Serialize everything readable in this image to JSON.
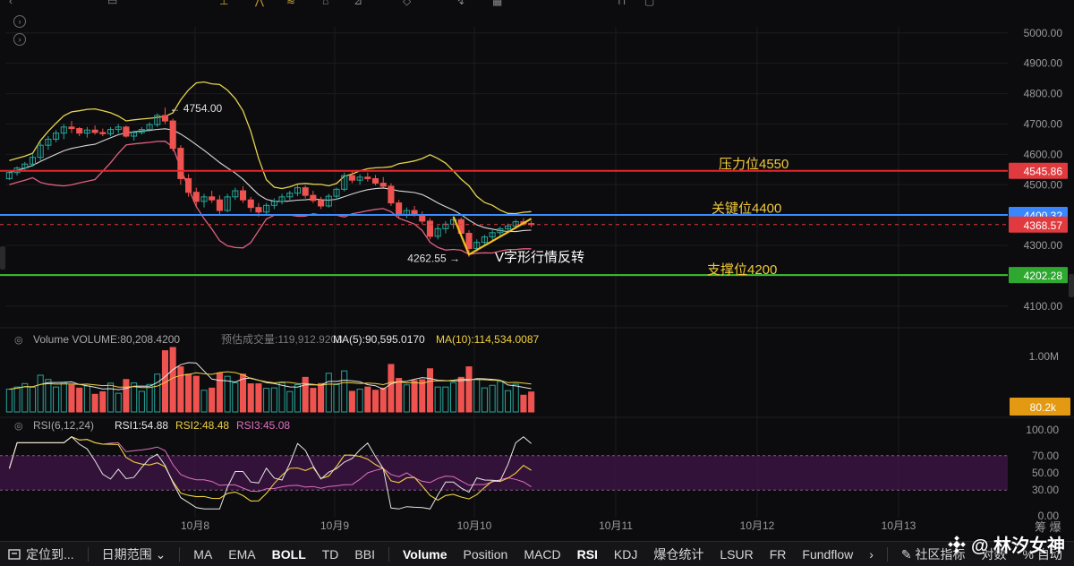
{
  "chart_data": {
    "type": "candlestick",
    "x_ticks": [
      "10月8",
      "10月9",
      "10月10",
      "10月11",
      "10月12",
      "10月13"
    ],
    "price_axis_ticks": [
      "5000.00",
      "4900.00",
      "4800.00",
      "4700.00",
      "4600.00",
      "4500.00",
      "4400.00",
      "4300.00",
      "4200.00",
      "4100.00"
    ],
    "ylim": [
      4070,
      5020
    ],
    "candles": [
      [
        4520,
        4545,
        4515,
        4540
      ],
      [
        4540,
        4560,
        4530,
        4555
      ],
      [
        4555,
        4575,
        4548,
        4568
      ],
      [
        4568,
        4600,
        4560,
        4590
      ],
      [
        4590,
        4640,
        4580,
        4630
      ],
      [
        4630,
        4660,
        4615,
        4650
      ],
      [
        4650,
        4680,
        4640,
        4670
      ],
      [
        4670,
        4700,
        4650,
        4690
      ],
      [
        4690,
        4710,
        4670,
        4685
      ],
      [
        4685,
        4690,
        4660,
        4670
      ],
      [
        4670,
        4690,
        4655,
        4680
      ],
      [
        4680,
        4695,
        4665,
        4672
      ],
      [
        4672,
        4685,
        4660,
        4668
      ],
      [
        4668,
        4690,
        4660,
        4682
      ],
      [
        4682,
        4700,
        4670,
        4690
      ],
      [
        4690,
        4695,
        4655,
        4660
      ],
      [
        4660,
        4678,
        4645,
        4672
      ],
      [
        4672,
        4690,
        4665,
        4682
      ],
      [
        4682,
        4705,
        4675,
        4698
      ],
      [
        4698,
        4735,
        4690,
        4728
      ],
      [
        4728,
        4754,
        4700,
        4710
      ],
      [
        4710,
        4718,
        4610,
        4620
      ],
      [
        4620,
        4630,
        4500,
        4520
      ],
      [
        4520,
        4535,
        4460,
        4475
      ],
      [
        4475,
        4490,
        4430,
        4445
      ],
      [
        4445,
        4470,
        4425,
        4460
      ],
      [
        4460,
        4480,
        4440,
        4450
      ],
      [
        4450,
        4465,
        4400,
        4415
      ],
      [
        4415,
        4470,
        4410,
        4460
      ],
      [
        4460,
        4490,
        4450,
        4480
      ],
      [
        4480,
        4495,
        4440,
        4450
      ],
      [
        4450,
        4460,
        4410,
        4425
      ],
      [
        4425,
        4440,
        4395,
        4410
      ],
      [
        4410,
        4440,
        4400,
        4432
      ],
      [
        4432,
        4455,
        4420,
        4445
      ],
      [
        4445,
        4470,
        4435,
        4460
      ],
      [
        4460,
        4480,
        4445,
        4472
      ],
      [
        4472,
        4500,
        4462,
        4490
      ],
      [
        4490,
        4498,
        4455,
        4465
      ],
      [
        4465,
        4480,
        4440,
        4448
      ],
      [
        4448,
        4460,
        4420,
        4430
      ],
      [
        4430,
        4470,
        4425,
        4462
      ],
      [
        4462,
        4490,
        4450,
        4485
      ],
      [
        4485,
        4540,
        4478,
        4530
      ],
      [
        4530,
        4545,
        4505,
        4515
      ],
      [
        4515,
        4535,
        4500,
        4525
      ],
      [
        4525,
        4540,
        4510,
        4520
      ],
      [
        4520,
        4532,
        4498,
        4505
      ],
      [
        4505,
        4525,
        4490,
        4495
      ],
      [
        4495,
        4505,
        4430,
        4440
      ],
      [
        4440,
        4450,
        4390,
        4400
      ],
      [
        4400,
        4425,
        4390,
        4415
      ],
      [
        4415,
        4430,
        4395,
        4400
      ],
      [
        4400,
        4412,
        4370,
        4380
      ],
      [
        4380,
        4390,
        4320,
        4330
      ],
      [
        4330,
        4365,
        4320,
        4355
      ],
      [
        4355,
        4380,
        4340,
        4370
      ],
      [
        4370,
        4395,
        4355,
        4385
      ],
      [
        4385,
        4392,
        4330,
        4340
      ],
      [
        4340,
        4350,
        4262.55,
        4290
      ],
      [
        4290,
        4320,
        4280,
        4310
      ],
      [
        4310,
        4335,
        4300,
        4328
      ],
      [
        4328,
        4350,
        4318,
        4342
      ],
      [
        4342,
        4362,
        4330,
        4355
      ],
      [
        4355,
        4372,
        4345,
        4364
      ],
      [
        4364,
        4385,
        4355,
        4378
      ],
      [
        4378,
        4390,
        4365,
        4372
      ],
      [
        4372,
        4380,
        4360,
        4368.57
      ]
    ],
    "indicators": {
      "boll_label": "BOLL",
      "volume_label": "Volume",
      "volume_value": "VOLUME:80,208.4200",
      "volume_estimate": "预估成交量:119,912.9203",
      "volume_ma5": "MA(5):90,595.0170",
      "volume_ma10": "MA(10):114,534.0087",
      "volume_axis_tick": "1.00M",
      "volume_current_tag": "80.2k",
      "rsi_title": "RSI(6,12,24)",
      "rsi1": "RSI1:54.88",
      "rsi2": "RSI2:48.48",
      "rsi3": "RSI3:45.08",
      "rsi_axis_ticks": [
        "100.00",
        "70.00",
        "50.00",
        "30.00",
        "0.00"
      ]
    },
    "annotations": {
      "high_label": "4754.00",
      "low_label": "4262.55",
      "resistance_text": "压力位4550",
      "key_text": "关键位4400",
      "support_text": "支撑位4200",
      "pattern_text": "V字形行情反转"
    },
    "price_tags": [
      {
        "value": "4545.86",
        "color": "#e03a3e"
      },
      {
        "value": "4400.32",
        "color": "#3a86ff"
      },
      {
        "value": "4368.57",
        "color": "#e03a3e"
      },
      {
        "value": "4202.28",
        "color": "#2fa82f"
      }
    ],
    "level_lines": [
      {
        "value": 4545.86,
        "color": "#e8262c"
      },
      {
        "value": 4400.32,
        "color": "#3a8bff"
      },
      {
        "value": 4202.28,
        "color": "#3fbf2f"
      }
    ],
    "colors": {
      "up": "#26a69a",
      "down": "#ef5350",
      "boll_upper": "#e6d44d",
      "boll_mid": "#d8d8d8",
      "boll_lower": "#e0607e",
      "rsi_band": "#3a1440"
    }
  },
  "bottom_bar": {
    "locate_label": "定位到...",
    "date_range_label": "日期范围",
    "main_indicators": [
      "MA",
      "EMA",
      "BOLL",
      "TD",
      "BBI"
    ],
    "sub_indicators": [
      "Volume",
      "Position",
      "MACD",
      "RSI",
      "KDJ",
      "爆仓统计",
      "LSUR",
      "FR",
      "Fundflow"
    ],
    "community_label": "社区指标",
    "contract_label": "对数",
    "auto_label": "自动"
  },
  "corner": {
    "text": "筹 爆"
  },
  "watermark": "@ 林汐女神"
}
